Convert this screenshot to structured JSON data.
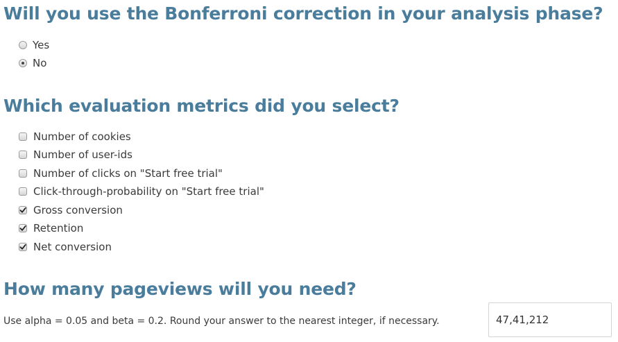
{
  "bonferroni": {
    "question": "Will you use the Bonferroni correction in your analysis phase?",
    "options": [
      {
        "label": "Yes",
        "checked": false
      },
      {
        "label": "No",
        "checked": true
      }
    ]
  },
  "metrics": {
    "question": "Which evaluation metrics did you select?",
    "options": [
      {
        "label": "Number of cookies",
        "checked": false
      },
      {
        "label": "Number of user-ids",
        "checked": false
      },
      {
        "label": "Number of clicks on \"Start free trial\"",
        "checked": false
      },
      {
        "label": "Click-through-probability on \"Start free trial\"",
        "checked": false
      },
      {
        "label": "Gross conversion",
        "checked": true
      },
      {
        "label": "Retention",
        "checked": true
      },
      {
        "label": "Net conversion",
        "checked": true
      }
    ]
  },
  "pageviews": {
    "question": "How many pageviews will you need?",
    "instruction": "Use alpha = 0.05 and beta = 0.2. Round your answer to the nearest integer, if necessary.",
    "answer_value": "47,41,212"
  }
}
